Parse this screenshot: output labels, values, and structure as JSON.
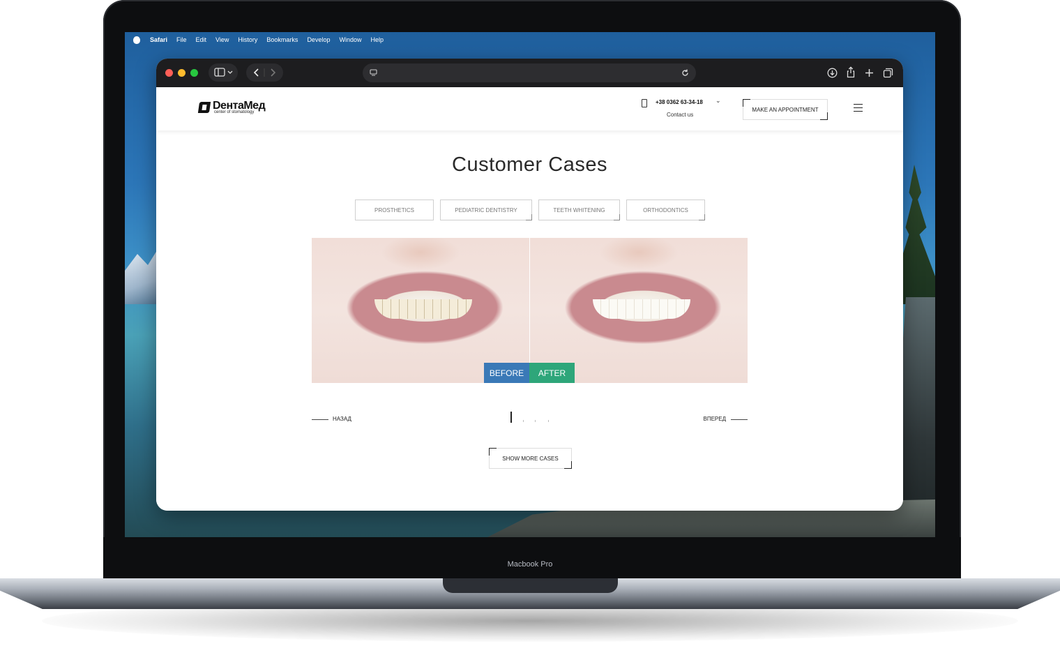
{
  "device": {
    "model_label": "Macbook Pro"
  },
  "menubar": {
    "items": [
      "Safari",
      "File",
      "Edit",
      "View",
      "History",
      "Bookmarks",
      "Develop",
      "Window",
      "Help"
    ]
  },
  "browser": {
    "traffic_lights": [
      "#ff5f57",
      "#febc2e",
      "#28c840"
    ],
    "icons": [
      "sidebar-icon",
      "back-icon",
      "forward-icon",
      "page-icon",
      "reload-icon",
      "download-icon",
      "share-icon",
      "new-tab-icon",
      "tabs-overview-icon"
    ]
  },
  "site": {
    "logo": {
      "name": "DентаМед",
      "subtitle": "center of stomatology"
    },
    "phone": "+38 0362 63-34-18",
    "contact": "Contact us",
    "cta": "MAKE AN APPOINTMENT",
    "title": "Customer Cases",
    "filters": [
      "PROSTHETICS",
      "PEDIATRIC DENTISTRY",
      "TEETH WHITENING",
      "ORTHODONTICS"
    ],
    "before_label": "BEFORE",
    "after_label": "AFTER",
    "before_color": "#3a79b7",
    "after_color": "#2ea67a",
    "prev_label": "НАЗАД",
    "next_label": "ВПЕРЕД",
    "show_more": "SHOW MORE CASES"
  }
}
